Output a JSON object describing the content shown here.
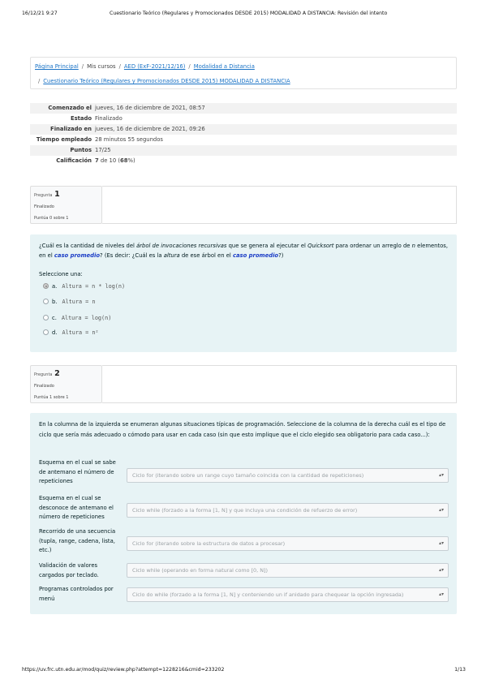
{
  "print_header": {
    "date": "16/12/21 9:27",
    "title": "Cuestionario Teórico (Regulares y Promocionados DESDE 2015) MODALIDAD A DISTANCIA: Revisión del intento"
  },
  "breadcrumb": {
    "items": [
      "Página Principal",
      "Mis cursos",
      "AED (ExF-2021/12/16)",
      "Modalidad a Distancia",
      "Cuestionario Teórico (Regulares y Promocionados DESDE 2015) MODALIDAD A DISTANCIA"
    ],
    "separator": "/"
  },
  "summary": {
    "rows": [
      {
        "label": "Comenzado el",
        "value": "jueves, 16 de diciembre de 2021, 08:57"
      },
      {
        "label": "Estado",
        "value": "Finalizado"
      },
      {
        "label": "Finalizado en",
        "value": "jueves, 16 de diciembre de 2021, 09:26"
      },
      {
        "label": "Tiempo empleado",
        "value": "28 minutos 55 segundos"
      },
      {
        "label": "Puntos",
        "value": "17/25"
      }
    ],
    "grade_label": "Calificación",
    "grade_value": "7",
    "grade_suffix": " de 10 (",
    "grade_pct": "68",
    "grade_end": "%)"
  },
  "question1": {
    "label": "Pregunta",
    "number": "1",
    "state": "Finalizado",
    "grade": "Puntúa 0 sobre 1",
    "text_parts": {
      "a": "¿Cuál es la cantidad de niveles del ",
      "b": "árbol de invocaciones recursivas",
      "c": " que se genera al ejecutar el ",
      "d": "Quicksort",
      "e": " para ordenar un arreglo de ",
      "f": "n",
      "g": " elementos, en el ",
      "h": "caso promedio",
      "i": "? (Es decir: ¿Cuál es la ",
      "j": "altura",
      "k": " de ese árbol en el ",
      "l": "caso promedio",
      "m": "?)"
    },
    "prompt": "Seleccione una:",
    "options": [
      {
        "letter": "a.",
        "text": "Altura = n * log(n)",
        "selected": true
      },
      {
        "letter": "b.",
        "text": "Altura = n",
        "selected": false
      },
      {
        "letter": "c.",
        "text": "Altura = log(n)",
        "selected": false
      },
      {
        "letter": "d.",
        "text": "Altura = n²",
        "selected": false
      }
    ]
  },
  "question2": {
    "label": "Pregunta",
    "number": "2",
    "state": "Finalizado",
    "grade": "Puntúa 1 sobre 1",
    "text": "En la columna de la izquierda se enumeran algunas situaciones típicas de programación. Seleccione de la columna de la derecha cuál es el tipo de ciclo que sería más adecuado o cómodo para usar en cada caso (sin que esto implique que el ciclo elegido sea obligatorio para cada caso...):",
    "rows": [
      {
        "label": "Esquema en el cual se sabe de antemano el número de repeticiones",
        "answer": "Ciclo for (iterando sobre un range cuyo tamaño coincida con la cantidad de repeticiones)"
      },
      {
        "label": "Esquema en el cual se desconoce de antemano el número de repeticiones",
        "answer": "Ciclo while (forzado a la forma [1, N] y que incluya una condición de refuerzo de error)"
      },
      {
        "label": "Recorrido de una secuencia (tupla, range, cadena, lista, etc.)",
        "answer": "Ciclo for (iterando sobre la estructura de datos a procesar)"
      },
      {
        "label": "Validación de valores cargados por teclado.",
        "answer": "Ciclo while (operando en forma natural como [0, N])"
      },
      {
        "label": "Programas controlados por menú",
        "answer": "Ciclo do while (forzado a la forma [1, N] y conteniendo un if anidado para chequear la opción ingresada)"
      }
    ]
  },
  "print_footer": {
    "url": "https://uv.frc.utn.edu.ar/mod/quiz/review.php?attempt=1228216&cmid=233202",
    "page": "1/13"
  },
  "colors": {
    "link": "#1a73c6",
    "question_bg": "#e7f3f5",
    "keyword": "#1a3cc6"
  }
}
